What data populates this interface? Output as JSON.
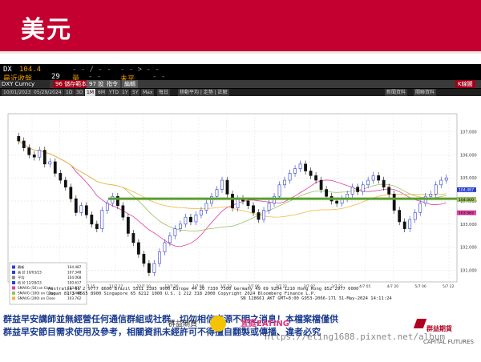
{
  "slide": {
    "title": "美元"
  },
  "terminal": {
    "ticker": "DX",
    "last": "104.4",
    "change": "- - / - -",
    "arrow": "- - > - -",
    "row2_label": "最近收盤",
    "row2_val": "29",
    "row2_label2": "量",
    "row2_dash": "- -",
    "row2_label3": "未平",
    "row2_dash2": "- -"
  },
  "toolbar": {
    "security": "DXY Curncy",
    "btn1": "96 儲存範本",
    "btn2": "97 設定",
    "btn3": "指令",
    "btn4": "編輯",
    "right": "K線圖"
  },
  "toolbar2": {
    "date_from": "10/01/2023",
    "date_to": "05/29/2024",
    "periods": [
      "1D",
      "3D",
      "1M",
      "6M",
      "YTD",
      "1Y",
      "5Y",
      "Max"
    ],
    "freq": "每日",
    "tools": "移動平均 | 走勢 | 註解",
    "right1": "新聞資料",
    "right2": "關聯資料"
  },
  "chart_data": {
    "type": "candlestick",
    "y_ticks": [
      "107.000",
      "106.000",
      "105.000",
      "104.000",
      "103.000",
      "102.000",
      "101.000"
    ],
    "y_range": [
      100.5,
      107.5
    ],
    "x_ticks": [
      "10/7 01",
      "10/7 31",
      "11/7 15",
      "11/7 27",
      "12/7 10",
      "12/7 26",
      "1/7 08",
      "1/7 23",
      "2/7 06",
      "2/7 21",
      "3/7 07",
      "3/7 21",
      "4/7 05",
      "4/7 20",
      "5/7 06",
      "5/7 22"
    ],
    "horizontal_line": 104.1,
    "last_label": "104.487",
    "moving_avg_labels": [
      "104.000",
      "103.562"
    ],
    "legend": {
      "rows": [
        {
          "label": "最新",
          "value": "104.487"
        },
        {
          "label": "高 於 10/03/23",
          "value": "107.348"
        },
        {
          "label": "平均",
          "value": "104.068"
        },
        {
          "label": "低 於 12/28/23",
          "value": "100.617"
        },
        {
          "label": "SMAVG (50) on Close",
          "value": "103.817"
        },
        {
          "label": "SMAVG (100) on Close",
          "value": "103.468"
        },
        {
          "label": "SMAVG (200) on Close",
          "value": "103.762"
        }
      ]
    },
    "bottom_text": "Australia 61 2 9777 8600 Brazil 5511 2395 9000 Europe 44 20 7330 7500 Germany 49 69 9204 1210 Hong Kong 852 2977 6000",
    "bottom_text2": "Japan 81 3 4565 8900    Singapore 65 6212 1000    U.S. 1 212 318 2000    Copyright 2024 Bloomberg Finance L.P.",
    "bottom_text3": "SN 128661 AKT GMT+8:00 G953-2066-171 31-May-2024 14:11:24"
  },
  "footer": {
    "line1": "群益早安講師並無經營任何通信群組或社群，切勿相信來源不明之消息！本檔案檔僅供",
    "line2": "群益早安節目需求使用及參考，相關資訊未經許可不得擅自翻製或傳播、違者必究",
    "logo_text": "群益期貨",
    "logo_eating": "宜庭EATING",
    "watermark": "https://eting1688.pixnet.net/album",
    "brand": "群益期貨",
    "brand_sub": "CAPITAL FUTURES"
  }
}
